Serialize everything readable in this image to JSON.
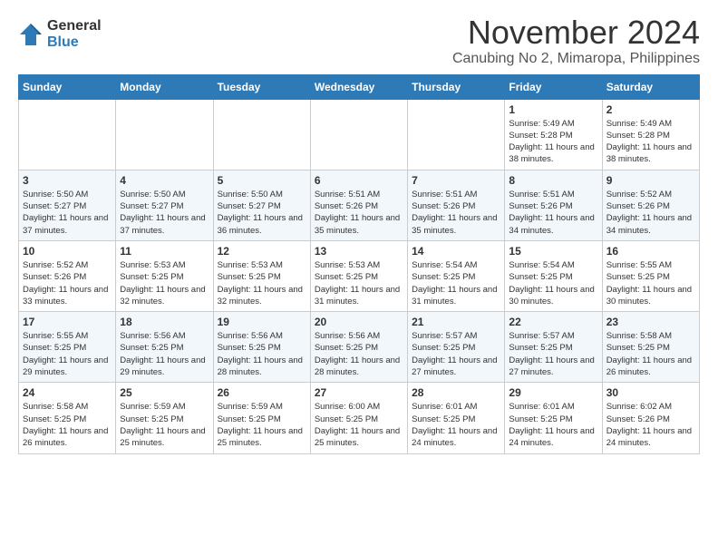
{
  "logo": {
    "general": "General",
    "blue": "Blue"
  },
  "title": "November 2024",
  "location": "Canubing No 2, Mimaropa, Philippines",
  "days_of_week": [
    "Sunday",
    "Monday",
    "Tuesday",
    "Wednesday",
    "Thursday",
    "Friday",
    "Saturday"
  ],
  "weeks": [
    [
      {
        "day": "",
        "info": ""
      },
      {
        "day": "",
        "info": ""
      },
      {
        "day": "",
        "info": ""
      },
      {
        "day": "",
        "info": ""
      },
      {
        "day": "",
        "info": ""
      },
      {
        "day": "1",
        "info": "Sunrise: 5:49 AM\nSunset: 5:28 PM\nDaylight: 11 hours and 38 minutes."
      },
      {
        "day": "2",
        "info": "Sunrise: 5:49 AM\nSunset: 5:28 PM\nDaylight: 11 hours and 38 minutes."
      }
    ],
    [
      {
        "day": "3",
        "info": "Sunrise: 5:50 AM\nSunset: 5:27 PM\nDaylight: 11 hours and 37 minutes."
      },
      {
        "day": "4",
        "info": "Sunrise: 5:50 AM\nSunset: 5:27 PM\nDaylight: 11 hours and 37 minutes."
      },
      {
        "day": "5",
        "info": "Sunrise: 5:50 AM\nSunset: 5:27 PM\nDaylight: 11 hours and 36 minutes."
      },
      {
        "day": "6",
        "info": "Sunrise: 5:51 AM\nSunset: 5:26 PM\nDaylight: 11 hours and 35 minutes."
      },
      {
        "day": "7",
        "info": "Sunrise: 5:51 AM\nSunset: 5:26 PM\nDaylight: 11 hours and 35 minutes."
      },
      {
        "day": "8",
        "info": "Sunrise: 5:51 AM\nSunset: 5:26 PM\nDaylight: 11 hours and 34 minutes."
      },
      {
        "day": "9",
        "info": "Sunrise: 5:52 AM\nSunset: 5:26 PM\nDaylight: 11 hours and 34 minutes."
      }
    ],
    [
      {
        "day": "10",
        "info": "Sunrise: 5:52 AM\nSunset: 5:26 PM\nDaylight: 11 hours and 33 minutes."
      },
      {
        "day": "11",
        "info": "Sunrise: 5:53 AM\nSunset: 5:25 PM\nDaylight: 11 hours and 32 minutes."
      },
      {
        "day": "12",
        "info": "Sunrise: 5:53 AM\nSunset: 5:25 PM\nDaylight: 11 hours and 32 minutes."
      },
      {
        "day": "13",
        "info": "Sunrise: 5:53 AM\nSunset: 5:25 PM\nDaylight: 11 hours and 31 minutes."
      },
      {
        "day": "14",
        "info": "Sunrise: 5:54 AM\nSunset: 5:25 PM\nDaylight: 11 hours and 31 minutes."
      },
      {
        "day": "15",
        "info": "Sunrise: 5:54 AM\nSunset: 5:25 PM\nDaylight: 11 hours and 30 minutes."
      },
      {
        "day": "16",
        "info": "Sunrise: 5:55 AM\nSunset: 5:25 PM\nDaylight: 11 hours and 30 minutes."
      }
    ],
    [
      {
        "day": "17",
        "info": "Sunrise: 5:55 AM\nSunset: 5:25 PM\nDaylight: 11 hours and 29 minutes."
      },
      {
        "day": "18",
        "info": "Sunrise: 5:56 AM\nSunset: 5:25 PM\nDaylight: 11 hours and 29 minutes."
      },
      {
        "day": "19",
        "info": "Sunrise: 5:56 AM\nSunset: 5:25 PM\nDaylight: 11 hours and 28 minutes."
      },
      {
        "day": "20",
        "info": "Sunrise: 5:56 AM\nSunset: 5:25 PM\nDaylight: 11 hours and 28 minutes."
      },
      {
        "day": "21",
        "info": "Sunrise: 5:57 AM\nSunset: 5:25 PM\nDaylight: 11 hours and 27 minutes."
      },
      {
        "day": "22",
        "info": "Sunrise: 5:57 AM\nSunset: 5:25 PM\nDaylight: 11 hours and 27 minutes."
      },
      {
        "day": "23",
        "info": "Sunrise: 5:58 AM\nSunset: 5:25 PM\nDaylight: 11 hours and 26 minutes."
      }
    ],
    [
      {
        "day": "24",
        "info": "Sunrise: 5:58 AM\nSunset: 5:25 PM\nDaylight: 11 hours and 26 minutes."
      },
      {
        "day": "25",
        "info": "Sunrise: 5:59 AM\nSunset: 5:25 PM\nDaylight: 11 hours and 25 minutes."
      },
      {
        "day": "26",
        "info": "Sunrise: 5:59 AM\nSunset: 5:25 PM\nDaylight: 11 hours and 25 minutes."
      },
      {
        "day": "27",
        "info": "Sunrise: 6:00 AM\nSunset: 5:25 PM\nDaylight: 11 hours and 25 minutes."
      },
      {
        "day": "28",
        "info": "Sunrise: 6:01 AM\nSunset: 5:25 PM\nDaylight: 11 hours and 24 minutes."
      },
      {
        "day": "29",
        "info": "Sunrise: 6:01 AM\nSunset: 5:25 PM\nDaylight: 11 hours and 24 minutes."
      },
      {
        "day": "30",
        "info": "Sunrise: 6:02 AM\nSunset: 5:26 PM\nDaylight: 11 hours and 24 minutes."
      }
    ]
  ]
}
